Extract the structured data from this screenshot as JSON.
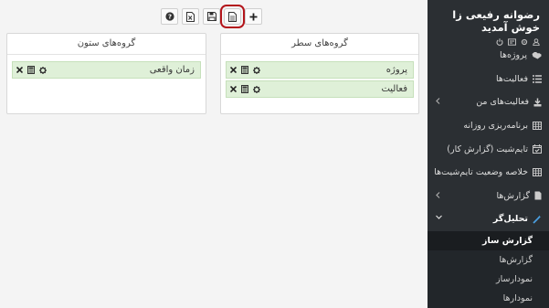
{
  "toolbar": {
    "buttons": [
      {
        "name": "help",
        "icon": "question-circle-icon"
      },
      {
        "name": "export-excel",
        "icon": "file-excel-icon"
      },
      {
        "name": "save",
        "icon": "floppy-disk-icon"
      },
      {
        "name": "new-report",
        "icon": "file-text-icon",
        "active": true
      },
      {
        "name": "add",
        "icon": "plus-icon"
      }
    ],
    "highlight_color": "#b3151b"
  },
  "row_groups": {
    "title": "گروه‌های سطر",
    "items": [
      {
        "label": "پروژه"
      },
      {
        "label": "فعالیت"
      }
    ]
  },
  "column_groups": {
    "title": "گروه‌های ستون",
    "items": [
      {
        "label": "زمان واقعی"
      }
    ]
  },
  "sidebar": {
    "user_name": "رضوانه رفیعی زا خوش آمدید",
    "user_icons": [
      "user-icon",
      "settings-icon",
      "id-card-icon",
      "power-icon"
    ],
    "items": [
      {
        "label": "پروژه‌ها",
        "icon": "handshake-icon"
      },
      {
        "label": "فعالیت‌ها",
        "icon": "list-icon"
      },
      {
        "label": "فعالیت‌های من",
        "icon": "download-icon",
        "chevron": true
      },
      {
        "label": "برنامه‌ریزی روزانه",
        "icon": "table-icon"
      },
      {
        "label": "تایم‌شیت (گزارش کار)",
        "icon": "calendar-check-icon"
      },
      {
        "label": "خلاصه وضعیت تایم‌شیت‌ها",
        "icon": "table-icon"
      },
      {
        "label": "گزارش‌ها",
        "icon": "file-icon",
        "chevron": true
      },
      {
        "label": "تحلیل‌گر",
        "icon": "wand-icon",
        "chevron": true,
        "open": true
      }
    ],
    "sub_items": [
      {
        "label": "گزارش ساز",
        "active": true
      },
      {
        "label": "گزارش‌ها"
      },
      {
        "label": "نمودارساز"
      },
      {
        "label": "نمودارها"
      }
    ],
    "colors": {
      "background": "#2b2f33",
      "accent": "#4a9fe0"
    }
  }
}
